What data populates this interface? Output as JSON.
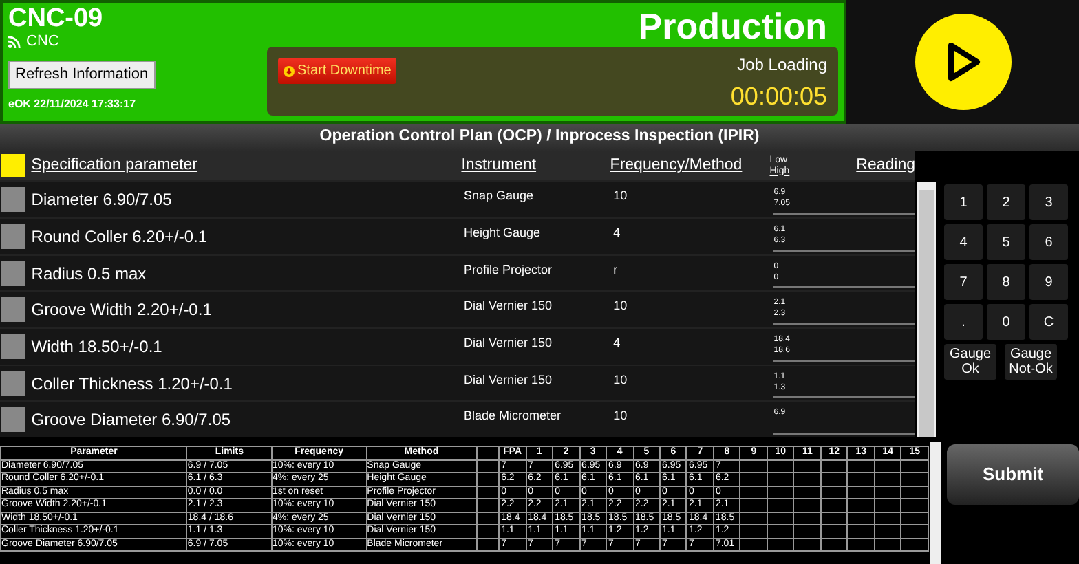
{
  "machine": {
    "title": "CNC-09",
    "subtitle": "CNC",
    "refresh_button": "Refresh Information",
    "status_line": "eOK 22/11/2024 17:33:17"
  },
  "production": {
    "title": "Production",
    "downtime_button": "Start Downtime",
    "job_status": "Job Loading",
    "timer": "00:00:05"
  },
  "ocp": {
    "title": "Operation Control Plan (OCP) / Inprocess Inspection (IPIR)",
    "columns": {
      "parameter": "Specification parameter",
      "instrument": "Instrument",
      "frequency": "Frequency/Method",
      "low": "Low",
      "high": "High",
      "reading": "Reading"
    },
    "rows": [
      {
        "parameter": "Diameter 6.90/7.05",
        "instrument": "Snap Gauge",
        "frequency": "10",
        "low": "6.9",
        "high": "7.05"
      },
      {
        "parameter": "Round Coller 6.20+/-0.1",
        "instrument": "Height Gauge",
        "frequency": "4",
        "low": "6.1",
        "high": "6.3"
      },
      {
        "parameter": "Radius 0.5 max",
        "instrument": "Profile Projector",
        "frequency": "r",
        "low": "0",
        "high": "0"
      },
      {
        "parameter": "Groove Width 2.20+/-0.1",
        "instrument": "Dial Vernier 150",
        "frequency": "10",
        "low": "2.1",
        "high": "2.3"
      },
      {
        "parameter": "Width 18.50+/-0.1",
        "instrument": "Dial Vernier 150",
        "frequency": "4",
        "low": "18.4",
        "high": "18.6"
      },
      {
        "parameter": "Coller Thickness 1.20+/-0.1",
        "instrument": "Dial Vernier 150",
        "frequency": "10",
        "low": "1.1",
        "high": "1.3"
      },
      {
        "parameter": "Groove Diameter 6.90/7.05",
        "instrument": "Blade Micrometer",
        "frequency": "10",
        "low": "6.9",
        "high": ""
      }
    ]
  },
  "keypad": {
    "keys": [
      "1",
      "2",
      "3",
      "4",
      "5",
      "6",
      "7",
      "8",
      "9",
      ".",
      "0",
      "C"
    ],
    "gauge_buttons": [
      "Gauge Ok",
      "Gauge Not-Ok"
    ]
  },
  "summary": {
    "columns": [
      "Parameter",
      "Limits",
      "Frequency",
      "Method",
      "FPA",
      "1",
      "2",
      "3",
      "4",
      "5",
      "6",
      "7",
      "8",
      "9",
      "10",
      "11",
      "12",
      "13",
      "14",
      "15"
    ],
    "rows": [
      {
        "parameter": "Diameter 6.90/7.05",
        "limits": "6.9 / 7.05",
        "frequency": "10%: every 10",
        "method": "Snap Gauge",
        "readings": [
          "7",
          "7",
          "6.95",
          "6.95",
          "6.9",
          "6.9",
          "6.95",
          "6.95",
          "7"
        ]
      },
      {
        "parameter": "Round Coller 6.20+/-0.1",
        "limits": "6.1 / 6.3",
        "frequency": "4%: every 25",
        "method": "Height Gauge",
        "readings": [
          "6.2",
          "6.2",
          "6.1",
          "6.1",
          "6.1",
          "6.1",
          "6.1",
          "6.1",
          "6.2"
        ]
      },
      {
        "parameter": "Radius 0.5 max",
        "limits": "0.0 / 0.0",
        "frequency": "1st on reset",
        "method": "Profile Projector",
        "readings": [
          "0",
          "0",
          "0",
          "0",
          "0",
          "0",
          "0",
          "0",
          "0"
        ]
      },
      {
        "parameter": "Groove Width 2.20+/-0.1",
        "limits": "2.1 / 2.3",
        "frequency": "10%: every 10",
        "method": "Dial Vernier 150",
        "readings": [
          "2.2",
          "2.2",
          "2.1",
          "2.1",
          "2.2",
          "2.2",
          "2.1",
          "2.1",
          "2.1"
        ]
      },
      {
        "parameter": "Width 18.50+/-0.1",
        "limits": "18.4 / 18.6",
        "frequency": "4%: every 25",
        "method": "Dial Vernier 150",
        "readings": [
          "18.4",
          "18.4",
          "18.5",
          "18.5",
          "18.5",
          "18.5",
          "18.5",
          "18.4",
          "18.5"
        ]
      },
      {
        "parameter": "Coller Thickness 1.20+/-0.1",
        "limits": "1.1 / 1.3",
        "frequency": "10%: every 10",
        "method": "Dial Vernier 150",
        "readings": [
          "1.1",
          "1.1",
          "1.1",
          "1.1",
          "1.2",
          "1.2",
          "1.1",
          "1.2",
          "1.2"
        ]
      },
      {
        "parameter": "Groove Diameter 6.90/7.05",
        "limits": "6.9 / 7.05",
        "frequency": "10%: every 10",
        "method": "Blade Micrometer",
        "readings": [
          "7",
          "7",
          "7",
          "7",
          "7",
          "7",
          "7",
          "7",
          "7.01"
        ]
      }
    ]
  },
  "submit_button": "Submit"
}
